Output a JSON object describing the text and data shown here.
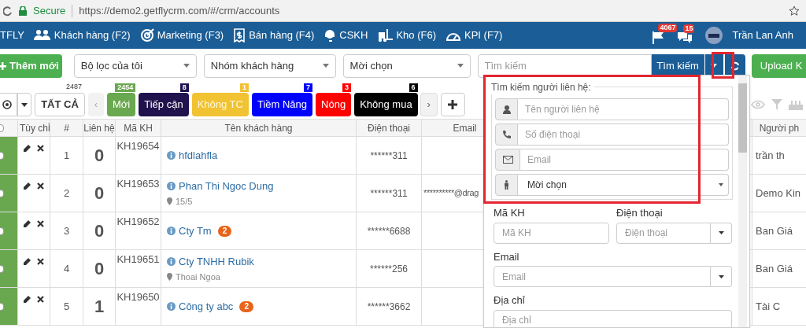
{
  "browser": {
    "secure_label": "Secure",
    "url": "https://demo2.getflycrm.com/#/crm/accounts"
  },
  "nav": {
    "brand": "TFLY",
    "items": [
      {
        "label": "Khách hàng (F2)"
      },
      {
        "label": "Marketing (F3)"
      },
      {
        "label": "Bán hàng (F4)"
      },
      {
        "label": "CSKH"
      },
      {
        "label": "Kho (F6)"
      },
      {
        "label": "KPI (F7)"
      }
    ],
    "notifications": [
      {
        "kind": "flag",
        "count": "4067"
      },
      {
        "kind": "chat",
        "count": "15"
      }
    ],
    "user": "Trần Lan Anh"
  },
  "toolbar": {
    "add_button": "Thêm mới",
    "filters": [
      "Bộ lọc của tôi",
      "Nhóm khách hàng",
      "Mời chọn"
    ],
    "search": {
      "placeholder": "Tìm kiếm",
      "button": "Tìm kiếm"
    },
    "upload_button": "Upload K"
  },
  "status_tabs": {
    "all": {
      "label": "TẤT CẢ",
      "count": "2487"
    },
    "prev": "‹",
    "next": "›",
    "tabs": [
      {
        "label": "Mới",
        "count": "2454",
        "color": "#6aa84f"
      },
      {
        "label": "Tiếp cận",
        "count": "8",
        "color": "#20124d"
      },
      {
        "label": "Không TC",
        "count": "1",
        "color": "#f1c232"
      },
      {
        "label": "Tiềm Năng",
        "count": "7",
        "color": "#0000ff"
      },
      {
        "label": "Nóng",
        "count": "3",
        "color": "#ff0000"
      },
      {
        "label": "Không mua",
        "count": "6",
        "color": "#000000"
      }
    ]
  },
  "table": {
    "all_checked": false,
    "columns": [
      "Tùy chỉ",
      "#",
      "Liên hệ",
      "Mã KH",
      "Tên khách hàng",
      "Điện thoại",
      "Email",
      "Người ph"
    ],
    "rows": [
      {
        "checked": false,
        "index": "1",
        "contacts": "0",
        "code": "KH19654",
        "name": "hfdlahfla",
        "phone": "******311",
        "owner": "trần th"
      },
      {
        "checked": false,
        "index": "2",
        "contacts": "0",
        "code": "KH19653",
        "name": "Phan Thi Ngoc Dung",
        "location": "15/5",
        "phone": "******311",
        "email": "**********@drag",
        "owner": "Demo Kin"
      },
      {
        "checked": false,
        "index": "3",
        "contacts": "0",
        "code": "KH19652",
        "name": "Cty Tm",
        "badge": "2",
        "phone": "******6688",
        "owner": "Ban Giá"
      },
      {
        "checked": false,
        "index": "4",
        "contacts": "0",
        "code": "KH19651",
        "name": "Cty TNHH Rubik",
        "location": "Thoai Ngoa",
        "phone": "******256",
        "owner": "Ban Giá"
      },
      {
        "checked": false,
        "index": "5",
        "contacts": "1",
        "code": "KH19650",
        "name": "Công ty abc",
        "badge": "2",
        "phone": "******3662",
        "owner": "Tài C"
      }
    ]
  },
  "search_panel": {
    "legend": "Tìm kiếm người liên hệ:",
    "contact_fields": [
      {
        "kind": "person",
        "placeholder": "Tên người liên hệ"
      },
      {
        "kind": "phone",
        "placeholder": "Số điện thoại"
      },
      {
        "kind": "email",
        "placeholder": "Email"
      },
      {
        "kind": "gender",
        "value": "Mời chọn"
      }
    ],
    "field_rows": [
      [
        {
          "label": "Mã KH",
          "placeholder": "Mã KH",
          "kind": "text"
        },
        {
          "label": "Điện thoại",
          "placeholder": "Điện thoại",
          "kind": "combo"
        }
      ],
      [
        {
          "label": "Email",
          "placeholder": "Email",
          "kind": "combo"
        }
      ],
      [
        {
          "label": "Địa chỉ",
          "placeholder": "Địa chỉ",
          "kind": "text"
        }
      ]
    ]
  }
}
